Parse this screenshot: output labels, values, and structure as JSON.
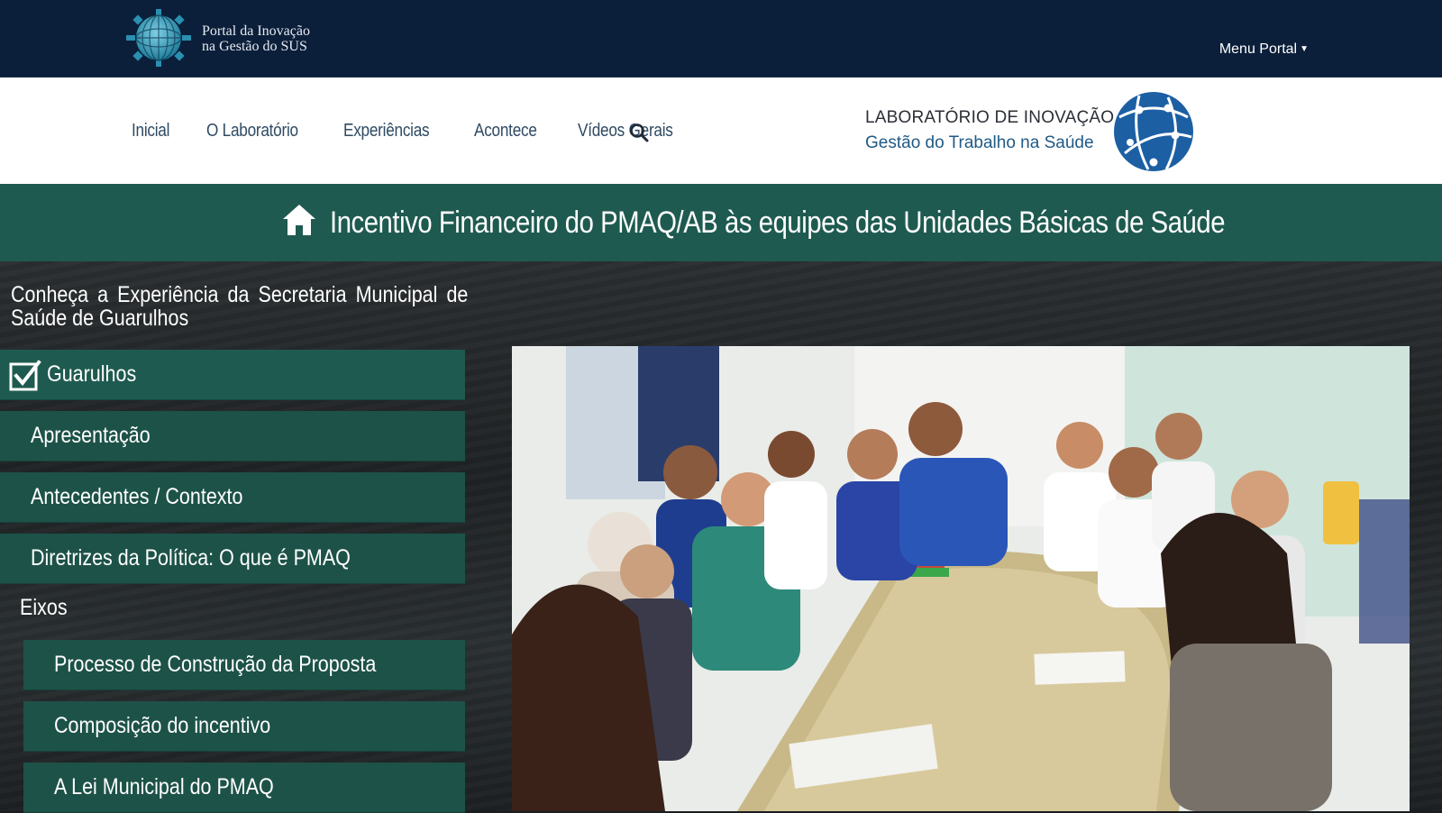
{
  "portal": {
    "line1": "Portal da Inovação",
    "line2": "na Gestão do SUS",
    "menu_label": "Menu Portal",
    "colors": {
      "bar": "#0b1f3a"
    }
  },
  "nav": {
    "links": [
      "Inicial",
      "O Laboratório",
      "Experiências",
      "Acontece",
      "Vídeos Gerais"
    ],
    "search_icon": "search-icon"
  },
  "lab": {
    "line1": "LABORATÓRIO DE INOVAÇÃO",
    "line2": "Gestão do Trabalho na Saúde",
    "colors": {
      "line2": "#1f5a86",
      "globe": "#1c5fa3"
    }
  },
  "page": {
    "title": "Incentivo Financeiro do PMAQ/AB às equipes das Unidades Básicas de Saúde",
    "home_icon": "home-icon",
    "colors": {
      "title_bar": "#1e5a50"
    }
  },
  "sidebar": {
    "intro": "Conheça a Experiência da Secretaria Municipal de Saúde de Guarulhos",
    "active_item": "Guarulhos",
    "items": [
      "Apresentação",
      "Antecedentes / Contexto",
      "Diretrizes da Política: O que é PMAQ"
    ],
    "group_label": "Eixos",
    "sub_items": [
      "Processo de Construção da Proposta",
      "Composição do incentivo",
      "A Lei Municipal do PMAQ"
    ],
    "colors": {
      "item_bg": "#1d5248"
    }
  }
}
